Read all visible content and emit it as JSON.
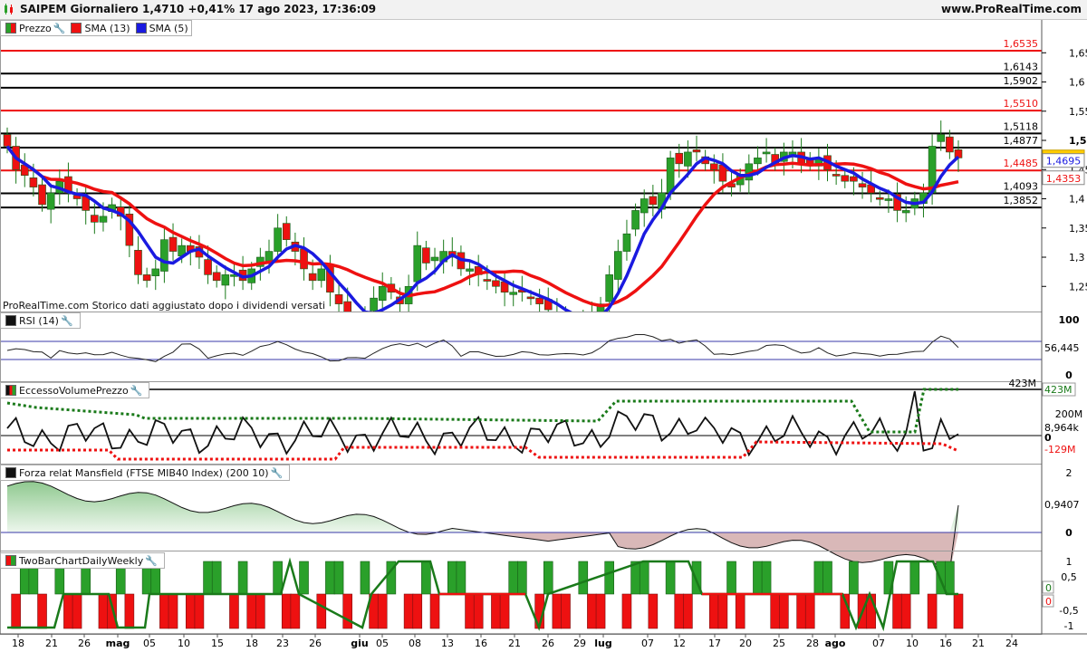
{
  "header": {
    "title": "SAIPEM Giornaliero 1,4710 +0,41% 17 ago 2023, 17:36:09",
    "site": "www.ProRealTime.com"
  },
  "legends": {
    "price": [
      {
        "label": "Prezzo",
        "color": "#2aa02a"
      },
      {
        "label": "SMA (13)",
        "color": "#ee1111"
      },
      {
        "label": "SMA (5)",
        "color": "#1a1ae0"
      }
    ],
    "rsi": "RSI (14)",
    "volume": "EccessoVolumePrezzo",
    "mansfield": "Forza relat Mansfield (FTSE MIB40 Index) (200 10)",
    "twobar": "TwoBarChartDailyWeekly"
  },
  "note": "ProRealTime.com Storico dati aggiustato dopo i dividendi versati",
  "price_axis": {
    "ticks": [
      "1,65",
      "1,6",
      "1,55",
      "1,5",
      "1,45",
      "1,4",
      "1,35",
      "1,3",
      "1,25"
    ],
    "tick_values": [
      1.65,
      1.6,
      1.55,
      1.5,
      1.45,
      1.4,
      1.35,
      1.3,
      1.25
    ],
    "range": [
      1.207,
      1.683
    ]
  },
  "levels": [
    {
      "value": 1.6535,
      "label": "1,6535",
      "color": "#ee1111"
    },
    {
      "value": 1.6143,
      "label": "1,6143",
      "color": "#000000"
    },
    {
      "value": 1.5902,
      "label": "1,5902",
      "color": "#000000"
    },
    {
      "value": 1.551,
      "label": "1,5510",
      "color": "#ee1111"
    },
    {
      "value": 1.5118,
      "label": "1,5118",
      "color": "#000000"
    },
    {
      "value": 1.4877,
      "label": "1,4877",
      "color": "#000000"
    },
    {
      "value": 1.4485,
      "label": "1,4485",
      "color": "#ee1111"
    },
    {
      "value": 1.4093,
      "label": "1,4093",
      "color": "#000000"
    },
    {
      "value": 1.3852,
      "label": "1,3852",
      "color": "#000000"
    }
  ],
  "price_badges": [
    {
      "value": 1.471,
      "label": "1,4710",
      "bg": "#ffcc00",
      "fg": "#000000"
    },
    {
      "value": 1.4695,
      "label": "1,4695",
      "bg": "#ffffff",
      "fg": "#1a1ae0"
    },
    {
      "value": 1.4353,
      "label": "1,4353",
      "bg": "#ffffff",
      "fg": "#ee1111"
    }
  ],
  "rsi": {
    "ticks": [
      "100",
      "0"
    ],
    "value_label": "56,445",
    "upper": 70,
    "lower": 30
  },
  "volume": {
    "ticks": [
      "200M",
      "0"
    ],
    "labels": [
      "423M",
      "8,964k",
      "-129M"
    ],
    "top_label": "423M"
  },
  "mansfield": {
    "ticks": [
      "2",
      "0"
    ],
    "value_label": "0,9407"
  },
  "twobar": {
    "ticks": [
      "1",
      "0,5",
      "-0,5",
      "-1"
    ],
    "labels": [
      "0",
      "0"
    ]
  },
  "x_axis": {
    "labels": [
      {
        "text": "18",
        "bold": false
      },
      {
        "text": "21",
        "bold": false
      },
      {
        "text": "26",
        "bold": false
      },
      {
        "text": "mag",
        "bold": true
      },
      {
        "text": "05",
        "bold": false
      },
      {
        "text": "10",
        "bold": false
      },
      {
        "text": "15",
        "bold": false
      },
      {
        "text": "18",
        "bold": false
      },
      {
        "text": "23",
        "bold": false
      },
      {
        "text": "26",
        "bold": false
      },
      {
        "text": "giu",
        "bold": true
      },
      {
        "text": "05",
        "bold": false
      },
      {
        "text": "08",
        "bold": false
      },
      {
        "text": "13",
        "bold": false
      },
      {
        "text": "16",
        "bold": false
      },
      {
        "text": "21",
        "bold": false
      },
      {
        "text": "26",
        "bold": false
      },
      {
        "text": "29",
        "bold": false
      },
      {
        "text": "lug",
        "bold": true
      },
      {
        "text": "07",
        "bold": false
      },
      {
        "text": "12",
        "bold": false
      },
      {
        "text": "17",
        "bold": false
      },
      {
        "text": "20",
        "bold": false
      },
      {
        "text": "25",
        "bold": false
      },
      {
        "text": "28",
        "bold": false
      },
      {
        "text": "ago",
        "bold": true
      },
      {
        "text": "07",
        "bold": false
      },
      {
        "text": "10",
        "bold": false
      },
      {
        "text": "16",
        "bold": false
      },
      {
        "text": "21",
        "bold": false
      },
      {
        "text": "24",
        "bold": false
      }
    ]
  },
  "chart_data": {
    "type": "candlestick",
    "series": [
      {
        "name": "Prezzo",
        "closes": [
          1.49,
          1.45,
          1.44,
          1.42,
          1.39,
          1.41,
          1.43,
          1.41,
          1.4,
          1.38,
          1.36,
          1.37,
          1.39,
          1.37,
          1.32,
          1.27,
          1.26,
          1.28,
          1.33,
          1.31,
          1.32,
          1.31,
          1.3,
          1.27,
          1.26,
          1.27,
          1.27,
          1.26,
          1.28,
          1.3,
          1.31,
          1.35,
          1.33,
          1.31,
          1.28,
          1.26,
          1.28,
          1.24,
          1.22,
          1.2,
          1.17,
          1.2,
          1.23,
          1.25,
          1.24,
          1.22,
          1.25,
          1.32,
          1.29,
          1.3,
          1.31,
          1.3,
          1.28,
          1.28,
          1.27,
          1.26,
          1.25,
          1.24,
          1.24,
          1.24,
          1.23,
          1.22,
          1.21,
          1.2,
          1.19,
          1.19,
          1.19,
          1.2,
          1.22,
          1.27,
          1.31,
          1.34,
          1.38,
          1.4,
          1.39,
          1.41,
          1.47,
          1.46,
          1.48,
          1.48,
          1.46,
          1.45,
          1.43,
          1.42,
          1.44,
          1.46,
          1.47,
          1.48,
          1.46,
          1.48,
          1.48,
          1.46,
          1.46,
          1.47,
          1.45,
          1.44,
          1.43,
          1.43,
          1.42,
          1.41,
          1.4,
          1.4,
          1.38,
          1.38,
          1.4,
          1.41,
          1.49,
          1.51,
          1.48,
          1.47
        ]
      },
      {
        "name": "SMA (13)"
      },
      {
        "name": "SMA (5)"
      }
    ],
    "levels": [
      1.6535,
      1.6143,
      1.5902,
      1.551,
      1.5118,
      1.4877,
      1.4485,
      1.4093,
      1.3852
    ],
    "rsi_last": 56.445,
    "mansfield_last": 0.9407
  }
}
